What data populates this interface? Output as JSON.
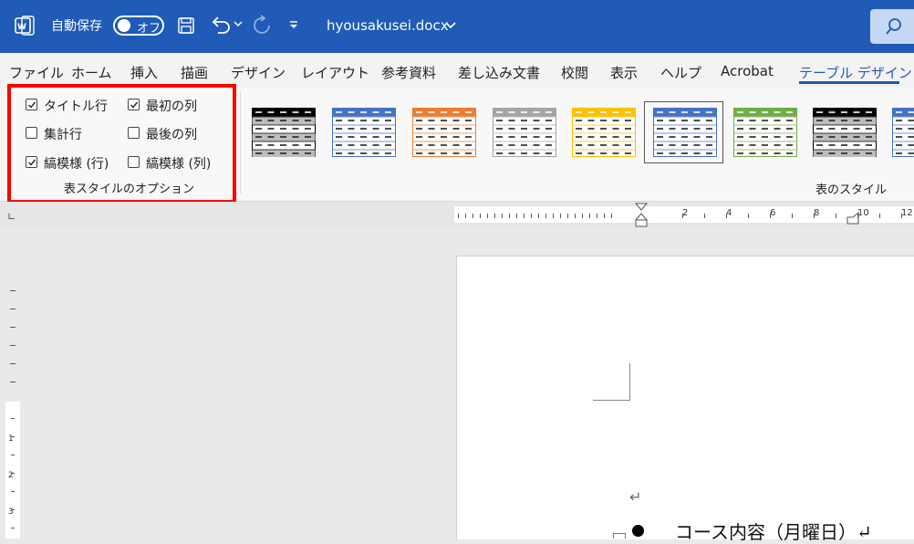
{
  "titlebar": {
    "autosave_label": "自動保存",
    "toggle_state": "オフ",
    "filename": "hyousakusei.docx"
  },
  "tabs": [
    "ファイル",
    "ホーム",
    "挿入",
    "描画",
    "デザイン",
    "レイアウト",
    "参考資料",
    "差し込み文書",
    "校閲",
    "表示",
    "ヘルプ",
    "Acrobat",
    "テーブル デザイン"
  ],
  "active_tab": "テーブル デザイン",
  "table_style_options": {
    "group_label": "表スタイルのオプション",
    "options": [
      {
        "label": "タイトル行",
        "checked": true
      },
      {
        "label": "最初の列",
        "checked": true
      },
      {
        "label": "集計行",
        "checked": false
      },
      {
        "label": "最後の列",
        "checked": false
      },
      {
        "label": "縞模様 (行)",
        "checked": true
      },
      {
        "label": "縞模様 (列)",
        "checked": false
      }
    ]
  },
  "table_styles": {
    "group_label": "表のスタイル",
    "colors": [
      "#000000",
      "#4472c4",
      "#ed7d31",
      "#a5a5a5",
      "#ffc000",
      "#4472c4",
      "#70ad47",
      "#000000",
      "#4472c4"
    ],
    "selected_index": 5
  },
  "ruler": {
    "numbers": [
      "2",
      "4",
      "6",
      "8",
      "10",
      "12"
    ]
  },
  "vruler": {
    "numbers": [
      "1",
      "2",
      "3"
    ]
  },
  "document": {
    "paragraph_mark": "↵",
    "bullet_text": "コース内容（月曜日）↵"
  }
}
